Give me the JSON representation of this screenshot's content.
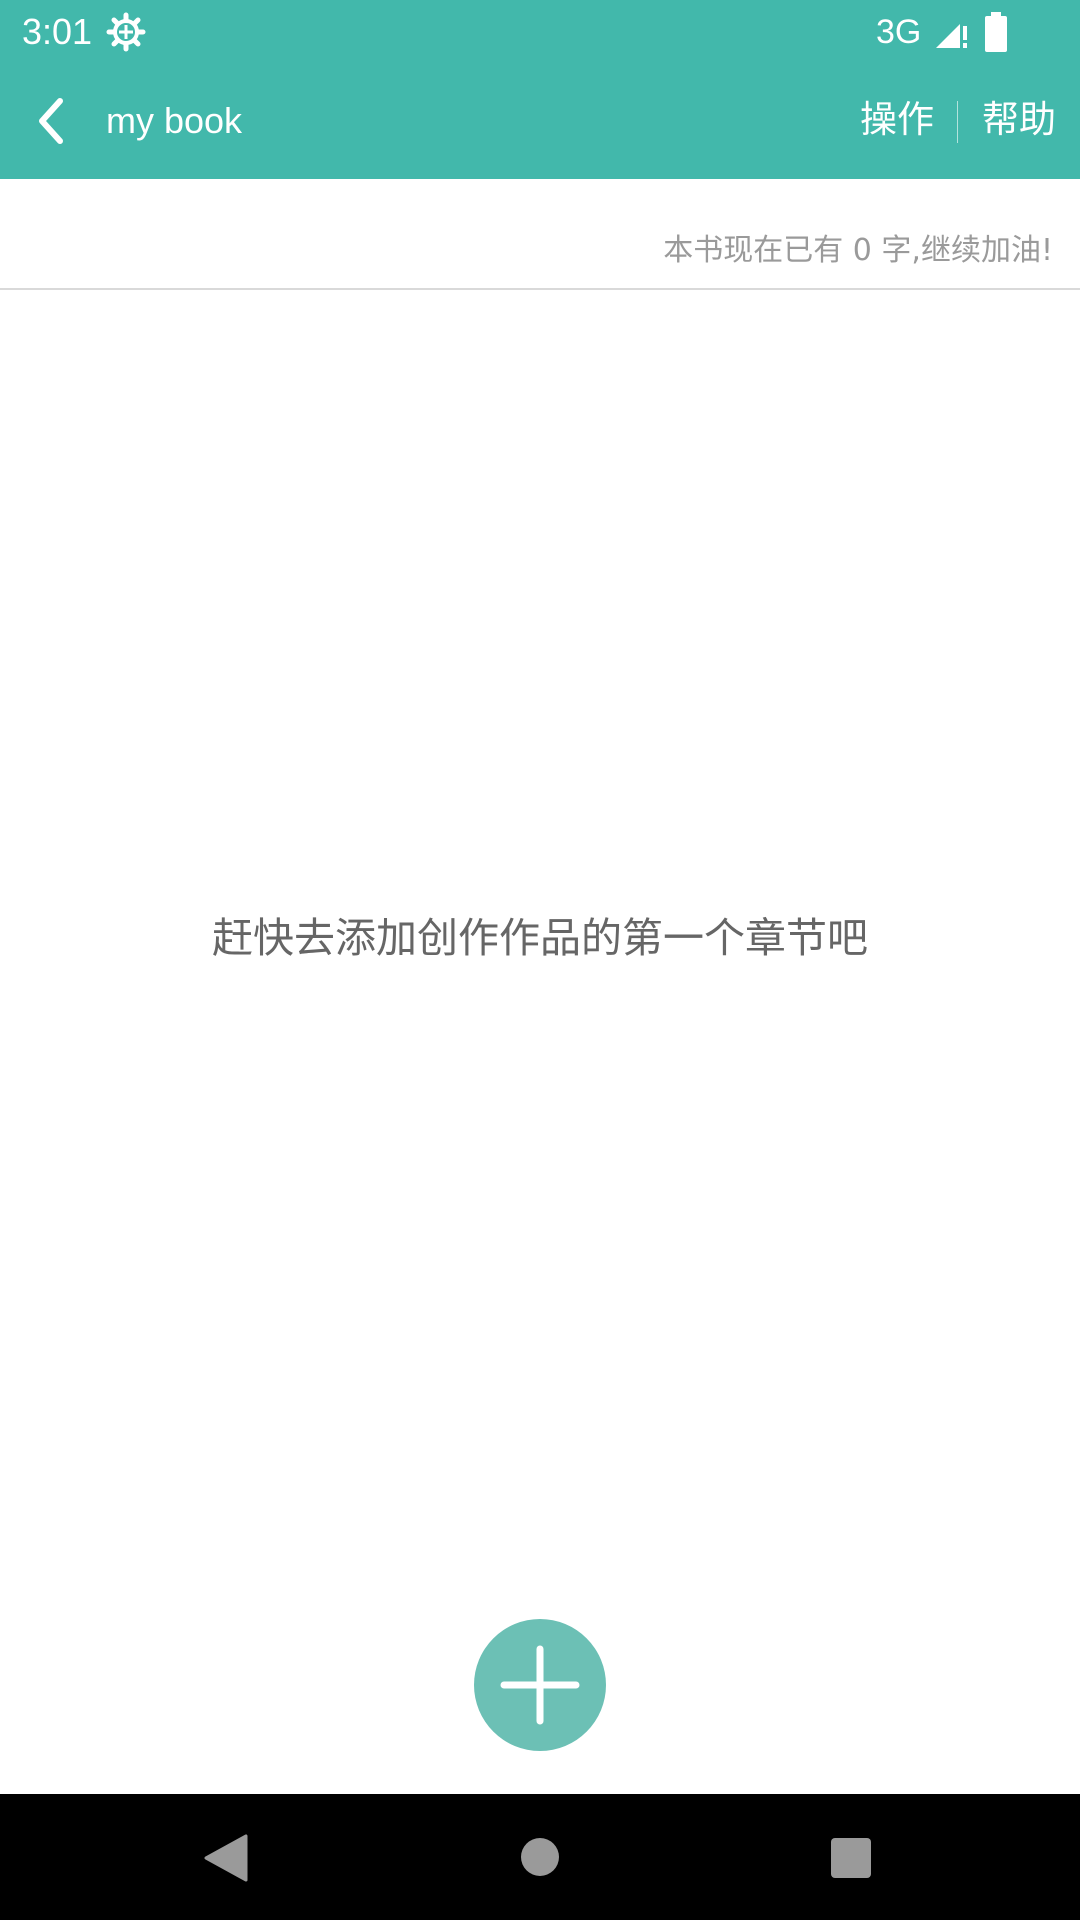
{
  "status_bar": {
    "time": "3:01",
    "network": "3G",
    "icons": [
      "gear-icon",
      "signal-icon",
      "battery-icon"
    ]
  },
  "toolbar": {
    "title": "my book",
    "back_icon": "chevron-left-icon",
    "operate_label": "操作",
    "help_label": "帮助"
  },
  "word_count": {
    "text": "本书现在已有 0 字,继续加油!"
  },
  "empty_state": {
    "message": "赶快去添加创作作品的第一个章节吧"
  },
  "fab": {
    "icon": "plus-icon"
  },
  "nav_bar": {
    "icons": [
      "triangle-back-icon",
      "circle-home-icon",
      "square-recents-icon"
    ]
  },
  "colors": {
    "primary": "#42b8ab",
    "fab": "#6cc0b5",
    "secondary_text": "#9a9a9a",
    "body_text": "#666666"
  }
}
